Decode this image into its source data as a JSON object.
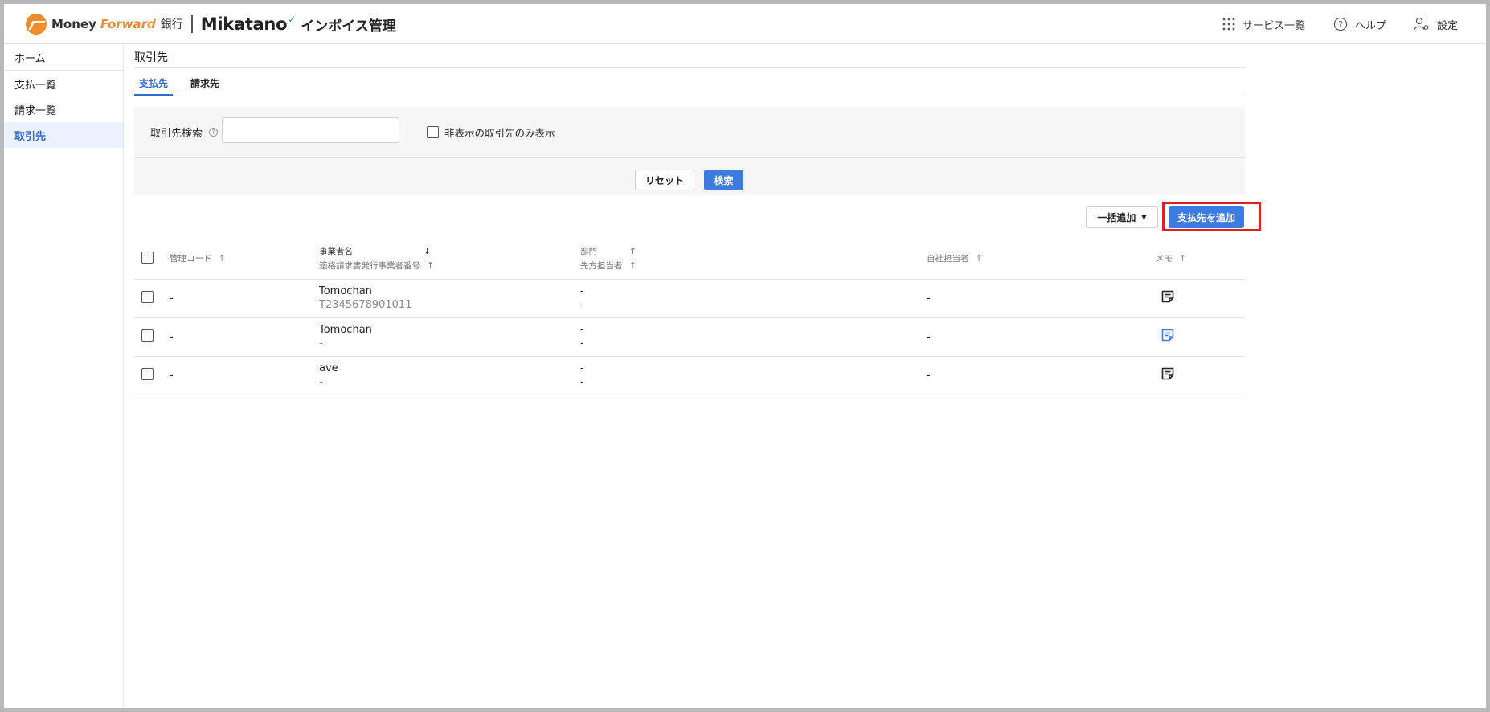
{
  "header": {
    "logo_money": "Money",
    "logo_forward": "Forward",
    "logo_bank": "銀行",
    "logo_mikatano": "Mikatano",
    "logo_app": "インボイス管理",
    "nav": {
      "services": "サービス一覧",
      "help": "ヘルプ",
      "settings": "設定"
    }
  },
  "sidebar": {
    "items": [
      {
        "label": "ホーム"
      },
      {
        "label": "支払一覧"
      },
      {
        "label": "請求一覧"
      },
      {
        "label": "取引先"
      }
    ],
    "active_index": 3
  },
  "main": {
    "title": "取引先",
    "tabs": [
      {
        "label": "支払先",
        "active": true
      },
      {
        "label": "請求先",
        "active": false
      }
    ],
    "search": {
      "label": "取引先検索",
      "help": "?",
      "value": "",
      "placeholder": "",
      "hidden_only_label": "非表示の取引先のみ表示",
      "hidden_only_checked": false,
      "reset_label": "リセット",
      "search_label": "検索"
    },
    "actions": {
      "bulk_add_label": "一括追加",
      "add_payee_label": "支払先を追加"
    },
    "table": {
      "headers": {
        "code": "管理コード",
        "name": "事業者名",
        "invoice_no": "適格請求書発行事業者番号",
        "department": "部門",
        "contact": "先方担当者",
        "owner": "自社担当者",
        "memo": "メモ"
      },
      "rows": [
        {
          "code": "-",
          "name": "Tomochan",
          "invoice_no": "T2345678901011",
          "department": "-",
          "contact": "-",
          "owner": "-",
          "memo_color": "#222222"
        },
        {
          "code": "-",
          "name": "Tomochan",
          "invoice_no": "-",
          "department": "-",
          "contact": "-",
          "owner": "-",
          "memo_color": "#3c7be0"
        },
        {
          "code": "-",
          "name": "ave",
          "invoice_no": "-",
          "department": "-",
          "contact": "-",
          "owner": "-",
          "memo_color": "#222222"
        }
      ]
    }
  },
  "colors": {
    "accent": "#3c7be0",
    "brand_orange": "#f08c2c",
    "highlight_red": "#e02020",
    "active_bg": "#ebf1fc"
  }
}
